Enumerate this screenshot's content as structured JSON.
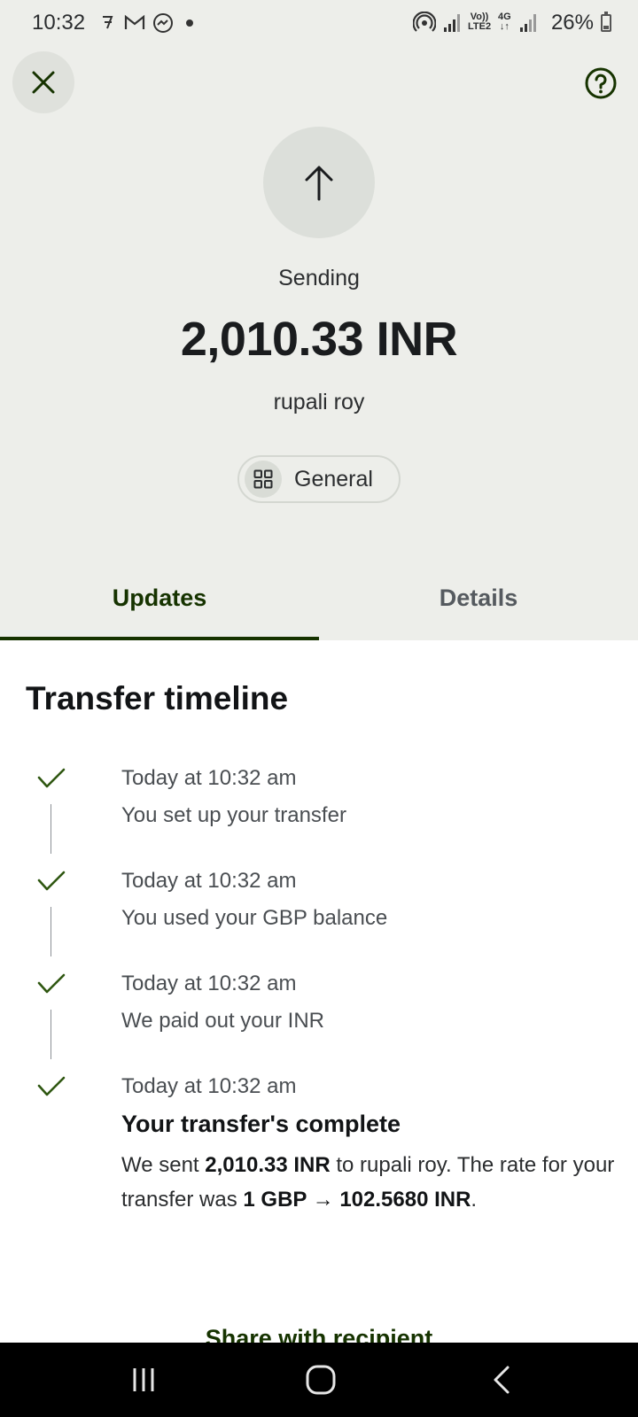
{
  "status_bar": {
    "time": "10:32",
    "battery": "26%",
    "battery_level_percent": 26,
    "net_volte": "Vo))",
    "net_lte": "LTE2",
    "net_4g": "4G",
    "net_arrows": "↓↑"
  },
  "header": {
    "status_label": "Sending",
    "amount": "2,010.33 INR",
    "recipient": "rupali roy",
    "category": "General"
  },
  "tabs": [
    {
      "label": "Updates",
      "active": true
    },
    {
      "label": "Details",
      "active": false
    }
  ],
  "timeline": {
    "title": "Transfer timeline",
    "events": [
      {
        "time": "Today at 10:32 am",
        "text": "You set up your transfer"
      },
      {
        "time": "Today at 10:32 am",
        "text": "You used your GBP balance"
      },
      {
        "time": "Today at 10:32 am",
        "text": "We paid out your INR"
      },
      {
        "time": "Today at 10:32 am",
        "heading": "Your transfer's complete"
      }
    ],
    "final_body": {
      "part1": "We sent ",
      "amount": "2,010.33 INR",
      "part2": " to rupali roy. The rate for your transfer was ",
      "rate": "1 GBP → 102.5680 INR",
      "part3": "."
    }
  },
  "share_link": "Share with recipient",
  "colors": {
    "accent": "#163300",
    "header_bg": "#edeeea",
    "check": "#2f5711"
  },
  "icons": {
    "close": "close-icon",
    "help": "help-icon",
    "send": "arrow-up-icon",
    "category": "grid-icon",
    "check": "check-icon"
  }
}
